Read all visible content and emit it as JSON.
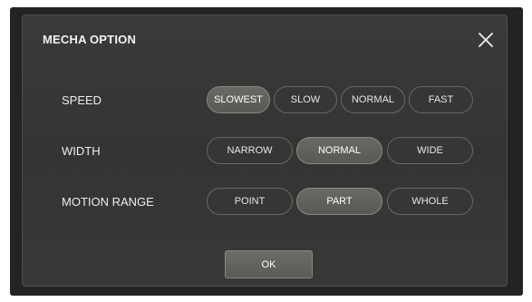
{
  "dialog": {
    "title": "MECHA OPTION",
    "close_icon": "close-x-icon",
    "ok_label": "OK"
  },
  "speed": {
    "label": "SPEED",
    "options": [
      "SLOWEST",
      "SLOW",
      "NORMAL",
      "FAST"
    ],
    "selected": "SLOWEST"
  },
  "width": {
    "label": "WIDTH",
    "options": [
      "NARROW",
      "NORMAL",
      "WIDE"
    ],
    "selected": "NORMAL"
  },
  "motion_range": {
    "label": "MOTION RANGE",
    "options": [
      "POINT",
      "PART",
      "WHOLE"
    ],
    "selected": "PART"
  },
  "colors": {
    "background": "#3a3836",
    "selected_button": "#64625f",
    "unselected_button": "#383634",
    "text": "#ececec"
  }
}
